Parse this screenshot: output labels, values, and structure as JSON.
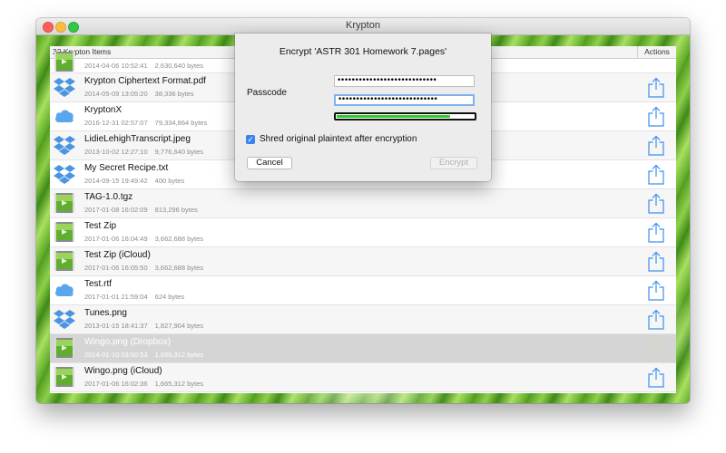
{
  "window": {
    "title": "Krypton"
  },
  "list": {
    "count_label": "32 Krypton Items",
    "actions_label": "Actions",
    "rows": [
      {
        "name": "",
        "date": "2014-04-06 10:52:41",
        "size": "2,630,640 bytes",
        "icon": "image-file-icon"
      },
      {
        "name": "Krypton Ciphertext Format.pdf",
        "date": "2014-05-09 13:05:20",
        "size": "38,336 bytes",
        "icon": "dropbox-icon"
      },
      {
        "name": "KryptonX",
        "date": "2016-12-31 02:57:07",
        "size": "79,334,864 bytes",
        "icon": "icloud-icon"
      },
      {
        "name": "LidieLehighTranscript.jpeg",
        "date": "2013-10-02 12:27:10",
        "size": "9,776,640 bytes",
        "icon": "dropbox-icon"
      },
      {
        "name": "My Secret Recipe.txt",
        "date": "2014-09-15 19:49:42",
        "size": "400 bytes",
        "icon": "dropbox-icon"
      },
      {
        "name": "TAG-1.0.tgz",
        "date": "2017-01-08 16:02:09",
        "size": "813,296 bytes",
        "icon": "image-file-icon"
      },
      {
        "name": "Test Zip",
        "date": "2017-01-06 16:04:49",
        "size": "3,662,688 bytes",
        "icon": "image-file-icon"
      },
      {
        "name": "Test Zip (iCloud)",
        "date": "2017-01-06 16:05:50",
        "size": "3,662,688 bytes",
        "icon": "image-file-icon"
      },
      {
        "name": "Test.rtf",
        "date": "2017-01-01 21:59:04",
        "size": "624 bytes",
        "icon": "icloud-icon"
      },
      {
        "name": "Tunes.png",
        "date": "2013-01-15 18:41:37",
        "size": "1,827,904 bytes",
        "icon": "dropbox-icon"
      },
      {
        "name": "Wingo.png (Dropbox)",
        "date": "2014-01-10 03:50:53",
        "size": "1,665,312 bytes",
        "icon": "image-file-icon"
      },
      {
        "name": "Wingo.png (iCloud)",
        "date": "2017-01-06 16:02:36",
        "size": "1,665,312 bytes",
        "icon": "image-file-icon"
      }
    ]
  },
  "dialog": {
    "title": "Encrypt 'ASTR 301 Homework 7.pages'",
    "passcode_label": "Passcode",
    "passcode_value": "••••••••••••••••••••••••••••",
    "passcode_confirm_value": "••••••••••••••••••••••••••••",
    "strength": 0.82,
    "shred_label": "Shred original plaintext after encryption",
    "shred_checked": true,
    "cancel_label": "Cancel",
    "encrypt_label": "Encrypt"
  },
  "colors": {
    "accent": "#3b82f0",
    "strength_bar": "#2ecc2e",
    "share_icon": "#3b8ff0",
    "dropbox": "#4a94e0",
    "icloud": "#5aa6ee"
  }
}
